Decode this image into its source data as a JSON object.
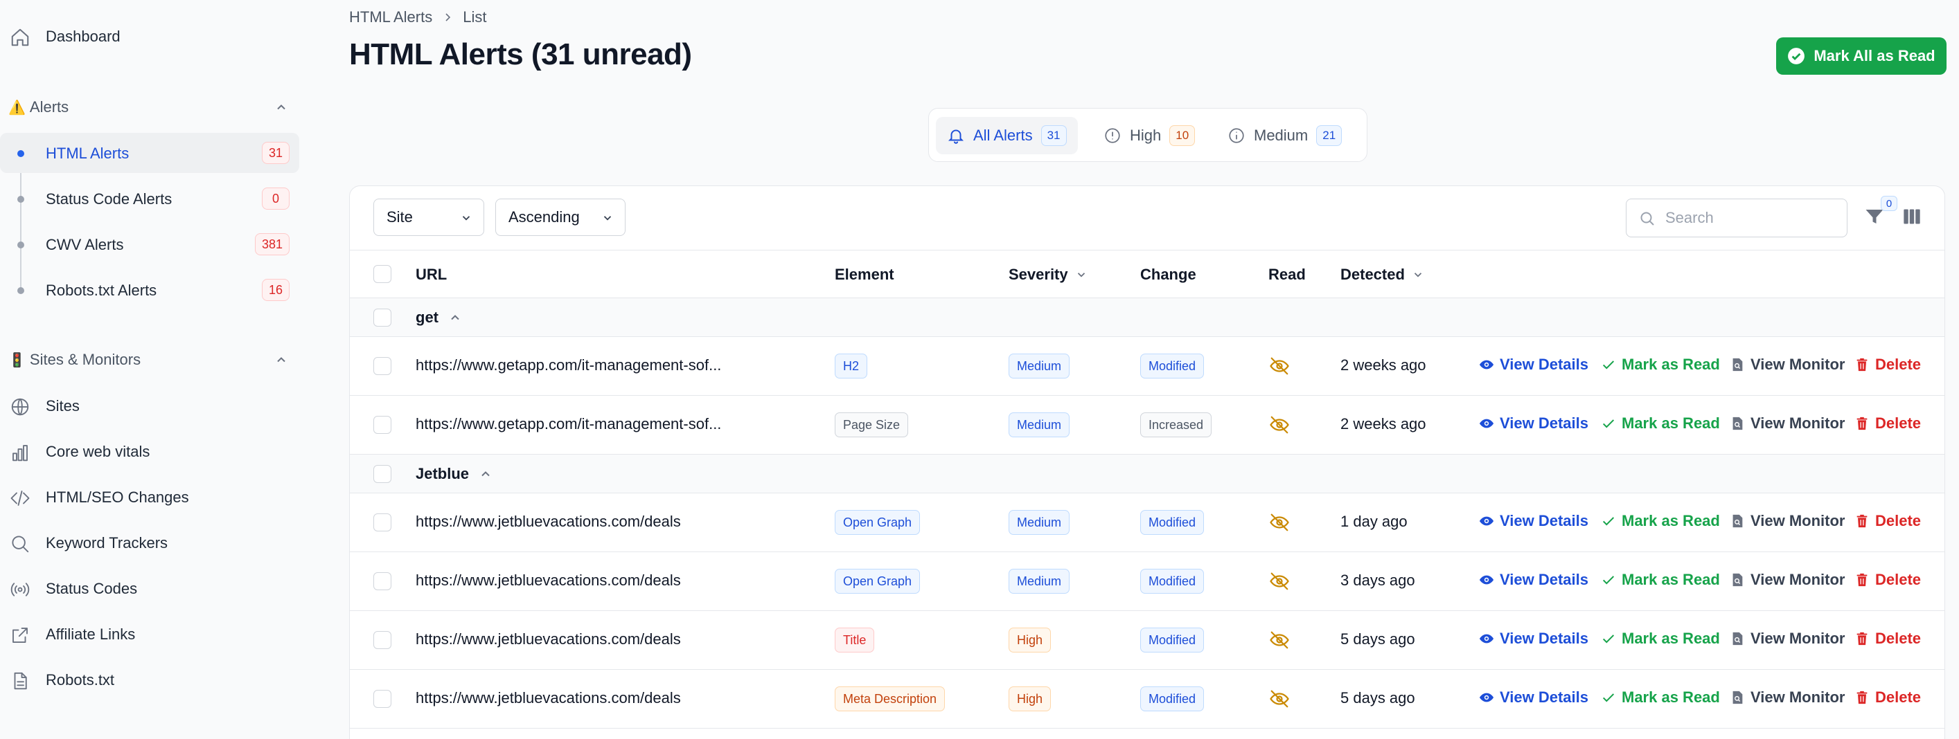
{
  "sidebar": {
    "dashboard": "Dashboard",
    "alerts_section": {
      "emoji": "⚠️",
      "label": "Alerts"
    },
    "alert_items": [
      {
        "label": "HTML Alerts",
        "count": "31",
        "active": true
      },
      {
        "label": "Status Code Alerts",
        "count": "0"
      },
      {
        "label": "CWV Alerts",
        "count": "381"
      },
      {
        "label": "Robots.txt Alerts",
        "count": "16"
      }
    ],
    "sites_section": {
      "emoji": "🚦",
      "label": "Sites & Monitors"
    },
    "site_items": [
      {
        "label": "Sites",
        "icon": "globe-icon"
      },
      {
        "label": "Core web vitals",
        "icon": "bar-chart-icon"
      },
      {
        "label": "HTML/SEO Changes",
        "icon": "code-icon"
      },
      {
        "label": "Keyword Trackers",
        "icon": "search-icon"
      },
      {
        "label": "Status Codes",
        "icon": "broadcast-icon"
      },
      {
        "label": "Affiliate Links",
        "icon": "external-link-icon"
      },
      {
        "label": "Robots.txt",
        "icon": "document-icon"
      }
    ]
  },
  "breadcrumb": {
    "root": "HTML Alerts",
    "current": "List"
  },
  "page_title": "HTML Alerts (31 unread)",
  "mark_all_button": "Mark All as Read",
  "tabs": [
    {
      "label": "All Alerts",
      "count": "31",
      "active": true
    },
    {
      "label": "High",
      "count": "10"
    },
    {
      "label": "Medium",
      "count": "21"
    }
  ],
  "filters": {
    "group_by": "Site",
    "order": "Ascending",
    "search_placeholder": "Search",
    "filter_count": "0"
  },
  "columns": {
    "url": "URL",
    "element": "Element",
    "severity": "Severity",
    "change": "Change",
    "read": "Read",
    "detected": "Detected"
  },
  "actions": {
    "view": "View Details",
    "mark": "Mark as Read",
    "monitor": "View Monitor",
    "delete": "Delete"
  },
  "groups": [
    {
      "name": "get",
      "rows": [
        {
          "url": "https://www.getapp.com/it-management-sof...",
          "element": "H2",
          "element_color": "blue",
          "severity": "Medium",
          "severity_color": "blue",
          "change": "Modified",
          "change_color": "blue",
          "detected": "2 weeks ago"
        },
        {
          "url": "https://www.getapp.com/it-management-sof...",
          "element": "Page Size",
          "element_color": "gray",
          "severity": "Medium",
          "severity_color": "blue",
          "change": "Increased",
          "change_color": "gray",
          "detected": "2 weeks ago"
        }
      ]
    },
    {
      "name": "Jetblue",
      "rows": [
        {
          "url": "https://www.jetbluevacations.com/deals",
          "element": "Open Graph",
          "element_color": "blue",
          "severity": "Medium",
          "severity_color": "blue",
          "change": "Modified",
          "change_color": "blue",
          "detected": "1 day ago"
        },
        {
          "url": "https://www.jetbluevacations.com/deals",
          "element": "Open Graph",
          "element_color": "blue",
          "severity": "Medium",
          "severity_color": "blue",
          "change": "Modified",
          "change_color": "blue",
          "detected": "3 days ago"
        },
        {
          "url": "https://www.jetbluevacations.com/deals",
          "element": "Title",
          "element_color": "red",
          "severity": "High",
          "severity_color": "orange",
          "change": "Modified",
          "change_color": "blue",
          "detected": "5 days ago"
        },
        {
          "url": "https://www.jetbluevacations.com/deals",
          "element": "Meta Description",
          "element_color": "orange",
          "severity": "High",
          "severity_color": "orange",
          "change": "Modified",
          "change_color": "blue",
          "detected": "5 days ago"
        }
      ]
    }
  ]
}
